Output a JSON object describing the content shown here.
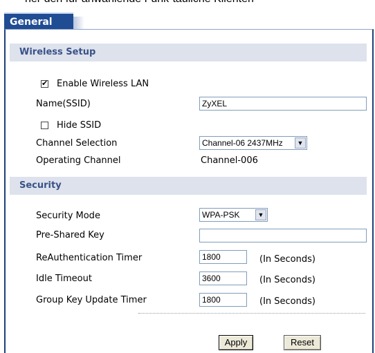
{
  "cut_text": "ner den für anwählende Funk-tauliche Klienten",
  "tab": {
    "label": "General"
  },
  "wireless": {
    "title": "Wireless Setup",
    "enable_label": "Enable Wireless LAN",
    "enable_checked": true,
    "ssid_label": "Name(SSID)",
    "ssid_value": "ZyXEL",
    "hide_label": "Hide SSID",
    "hide_checked": false,
    "channel_label": "Channel Selection",
    "channel_value": "Channel-06 2437MHz",
    "op_channel_label": "Operating Channel",
    "op_channel_value": "Channel-006"
  },
  "security": {
    "title": "Security",
    "mode_label": "Security Mode",
    "mode_value": "WPA-PSK",
    "psk_label": "Pre-Shared Key",
    "psk_value": "",
    "reauth_label": "ReAuthentication Timer",
    "reauth_value": "1800",
    "idle_label": "Idle Timeout",
    "idle_value": "3600",
    "gku_label": "Group Key Update Timer",
    "gku_value": "1800",
    "units": "(In Seconds)"
  },
  "buttons": {
    "apply": "Apply",
    "reset": "Reset"
  },
  "colors": {
    "tab_bg": "#1f4c93",
    "section_bg": "#dde2ec",
    "section_text": "#3a5288"
  }
}
